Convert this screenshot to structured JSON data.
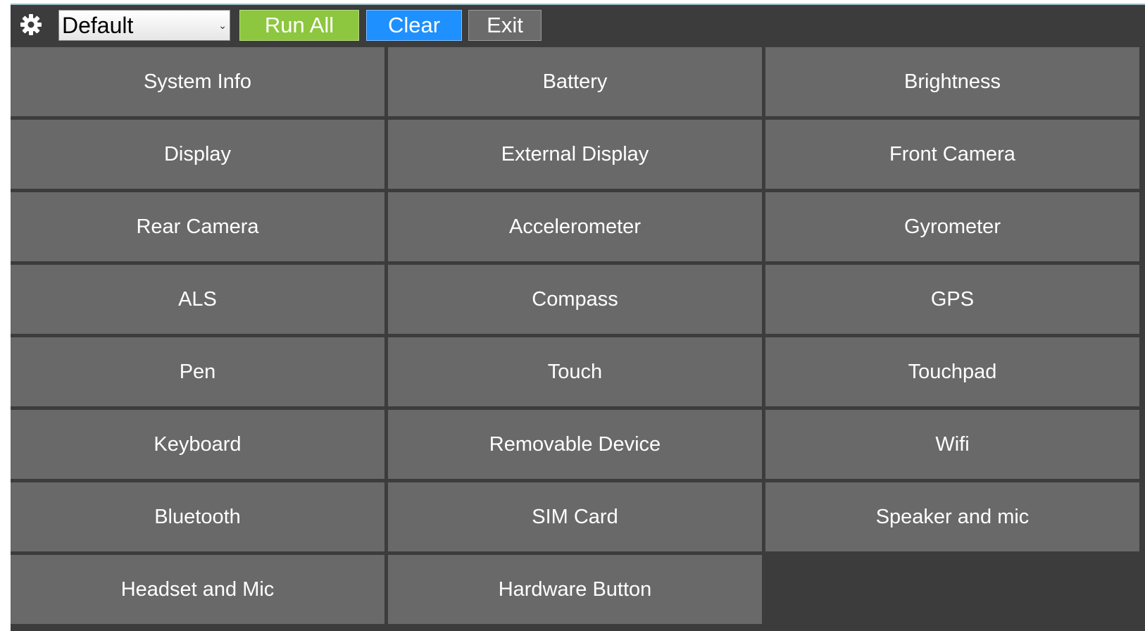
{
  "toolbar": {
    "icon": "gear-icon",
    "profile_selected": "Default",
    "run_all_label": "Run All",
    "clear_label": "Clear",
    "exit_label": "Exit"
  },
  "colors": {
    "background": "#3c3c3c",
    "tile": "#696969",
    "run_all": "#8dc63f",
    "clear": "#1e90ff",
    "exit": "#6b6b6b"
  },
  "tests": [
    {
      "label": "System Info"
    },
    {
      "label": "Battery"
    },
    {
      "label": "Brightness"
    },
    {
      "label": "Display"
    },
    {
      "label": "External Display"
    },
    {
      "label": "Front Camera"
    },
    {
      "label": "Rear Camera"
    },
    {
      "label": "Accelerometer"
    },
    {
      "label": "Gyrometer"
    },
    {
      "label": "ALS"
    },
    {
      "label": "Compass"
    },
    {
      "label": "GPS"
    },
    {
      "label": "Pen"
    },
    {
      "label": "Touch"
    },
    {
      "label": "Touchpad"
    },
    {
      "label": "Keyboard"
    },
    {
      "label": "Removable Device"
    },
    {
      "label": "Wifi"
    },
    {
      "label": "Bluetooth"
    },
    {
      "label": "SIM Card"
    },
    {
      "label": "Speaker and mic"
    },
    {
      "label": "Headset and Mic"
    },
    {
      "label": "Hardware Button"
    }
  ]
}
